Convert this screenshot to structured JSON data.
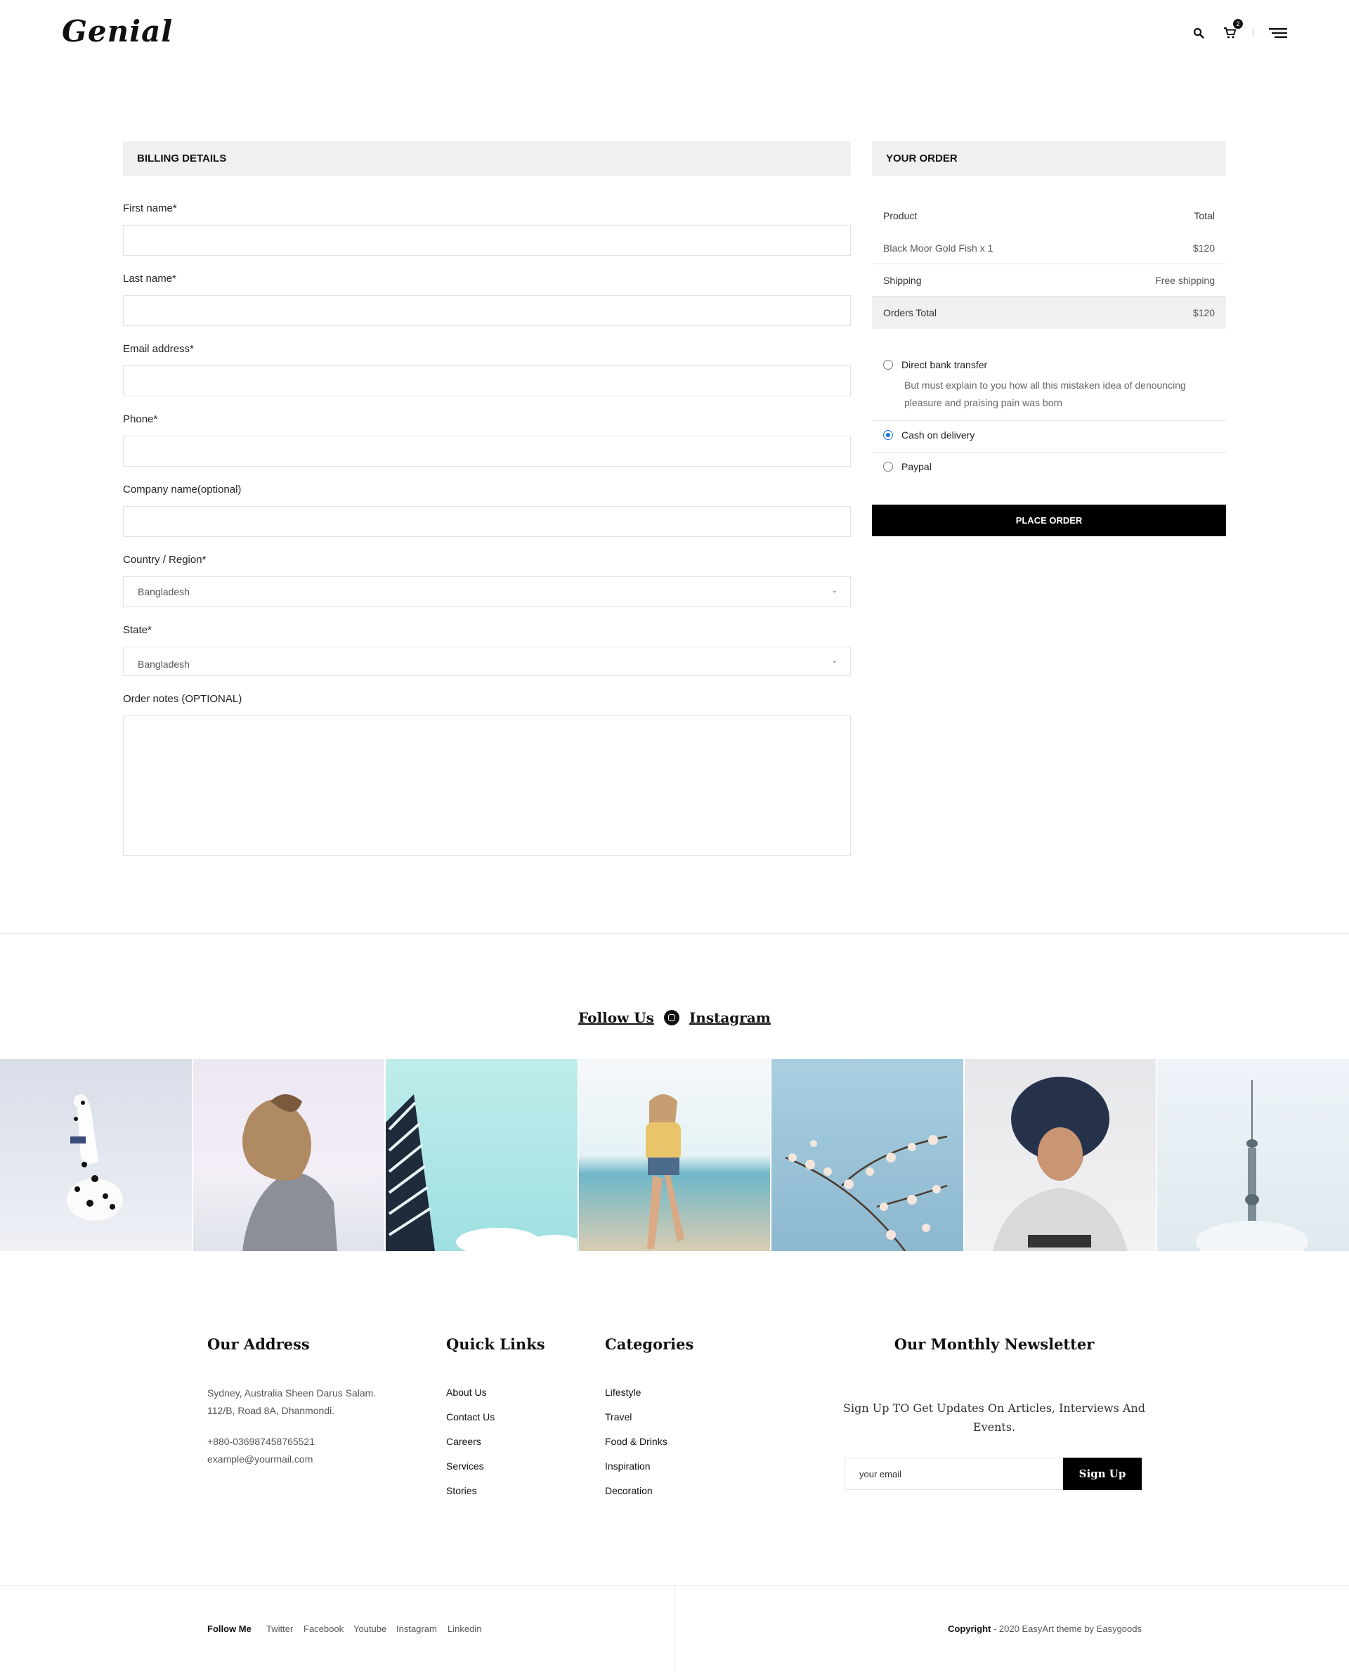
{
  "header": {
    "logo": "Genial",
    "cart_count": "2"
  },
  "billing": {
    "title": "BILLING DETAILS",
    "fields": {
      "first_name": "First name*",
      "last_name": "Last name*",
      "email": "Email address*",
      "phone": "Phone*",
      "company": "Company name(optional)",
      "country": "Country / Region*",
      "country_value": "Bangladesh",
      "state": "State*",
      "state_value": "Bangladesh",
      "notes": "Order notes (OPTIONAL)"
    }
  },
  "order": {
    "title": "YOUR ORDER",
    "head_product": "Product",
    "head_total": "Total",
    "item_name": "Black Moor Gold Fish x 1",
    "item_price": "$120",
    "shipping_label": "Shipping",
    "shipping_value": "Free shipping",
    "total_label": "Orders Total",
    "total_value": "$120",
    "payment": {
      "bank": "Direct bank transfer",
      "bank_desc": "But must explain to you how all this mistaken idea of denouncing pleasure and praising pain was born",
      "cod": "Cash on delivery",
      "paypal": "Paypal",
      "selected": "Cash on delivery"
    },
    "place_order": "PLACE ORDER"
  },
  "instagram": {
    "follow": "Follow Us",
    "network": "Instagram"
  },
  "footer": {
    "address_title": "Our Address",
    "address_line1": "Sydney, Australia Sheen Darus Salam.",
    "address_line2": "112/B, Road 8A, Dhanmondi.",
    "phone": "+880-036987458765521",
    "email": "example@yourmail.com",
    "quick_title": "Quick Links",
    "quick_links": [
      "About Us",
      "Contact Us",
      "Careers",
      "Services",
      "Stories"
    ],
    "cat_title": "Categories",
    "categories": [
      "Lifestyle",
      "Travel",
      "Food & Drinks",
      "Inspiration",
      "Decoration"
    ],
    "news_title": "Our Monthly Newsletter",
    "news_text": "Sign Up TO Get Updates On Articles, Interviews And Events.",
    "news_placeholder": "your email",
    "news_button": "Sign Up",
    "follow_me": "Follow Me",
    "social": [
      "Twitter",
      "Facebook",
      "Youtube",
      "Instagram",
      "Linkedin"
    ],
    "copyright_bold": "Copyright",
    "copyright_rest": " - 2020 EasyArt theme by Easygoods"
  }
}
